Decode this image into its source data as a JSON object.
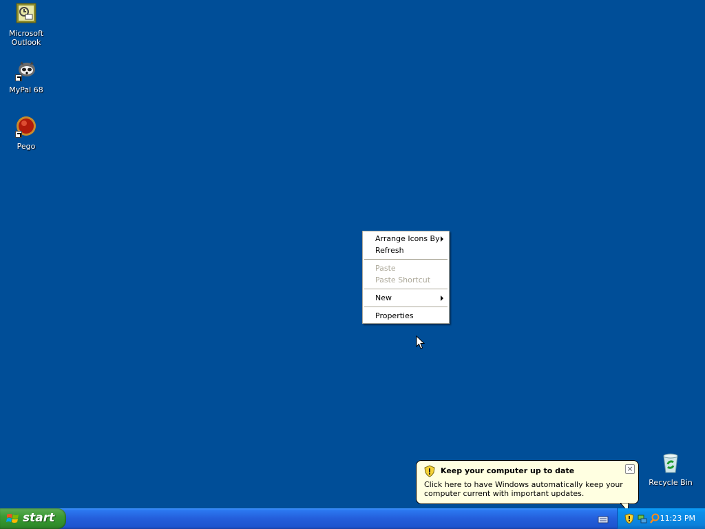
{
  "desktop": {
    "icons": [
      {
        "label": "Microsoft Outlook",
        "icon": "outlook-icon"
      },
      {
        "label": "MyPal 68",
        "icon": "mypal-icon"
      },
      {
        "label": "Pego",
        "icon": "pego-icon"
      },
      {
        "label": "Recycle Bin",
        "icon": "recycle-bin-icon"
      }
    ]
  },
  "context_menu": {
    "items": [
      {
        "label": "Arrange Icons By",
        "submenu": true,
        "disabled": false
      },
      {
        "label": "Refresh",
        "submenu": false,
        "disabled": false
      },
      {
        "label": "Paste",
        "submenu": false,
        "disabled": true
      },
      {
        "label": "Paste Shortcut",
        "submenu": false,
        "disabled": true
      },
      {
        "label": "New",
        "submenu": true,
        "disabled": false
      },
      {
        "label": "Properties",
        "submenu": false,
        "disabled": false
      }
    ]
  },
  "balloon": {
    "title": "Keep your computer up to date",
    "body": "Click here to have Windows automatically keep your computer current with important updates.",
    "close_label": "×"
  },
  "taskbar": {
    "start_label": "start",
    "clock": "11:23 PM",
    "tray_icons": [
      "security-shield-icon",
      "network-icon",
      "search-icon"
    ]
  },
  "colors": {
    "desktop_bg": "#004e98",
    "taskbar_blue": "#245edb",
    "start_green": "#3c9a34",
    "balloon_bg": "#ffffe1"
  }
}
